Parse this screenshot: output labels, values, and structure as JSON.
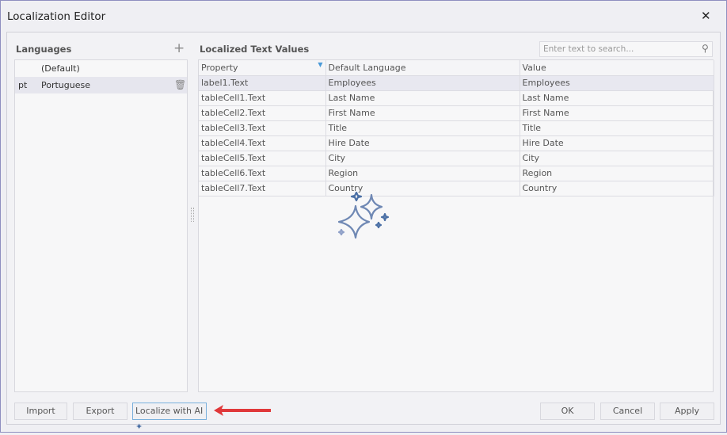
{
  "window": {
    "title": "Localization Editor",
    "close_icon": "close-icon"
  },
  "languages": {
    "header": "Languages",
    "items": [
      {
        "code": "",
        "name": "(Default)"
      },
      {
        "code": "pt",
        "name": "Portuguese"
      }
    ]
  },
  "values": {
    "header": "Localized Text Values",
    "search_placeholder": "Enter text to search...",
    "columns": [
      "Property",
      "Default Language",
      "Value"
    ],
    "rows": [
      [
        "label1.Text",
        "Employees",
        "Employees"
      ],
      [
        "tableCell1.Text",
        "Last Name",
        "Last Name"
      ],
      [
        "tableCell2.Text",
        "First Name",
        "First Name"
      ],
      [
        "tableCell3.Text",
        "Title",
        "Title"
      ],
      [
        "tableCell4.Text",
        "Hire Date",
        "Hire Date"
      ],
      [
        "tableCell5.Text",
        "City",
        "City"
      ],
      [
        "tableCell6.Text",
        "Region",
        "Region"
      ],
      [
        "tableCell7.Text",
        "Country",
        "Country"
      ]
    ]
  },
  "buttons": {
    "import": "Import",
    "export": "Export",
    "localize_ai": "Localize with AI",
    "ok": "OK",
    "cancel": "Cancel",
    "apply": "Apply"
  },
  "colors": {
    "accent": "#4a6fa5",
    "arrow": "#e0383a",
    "selection": "#e6e6ee"
  }
}
